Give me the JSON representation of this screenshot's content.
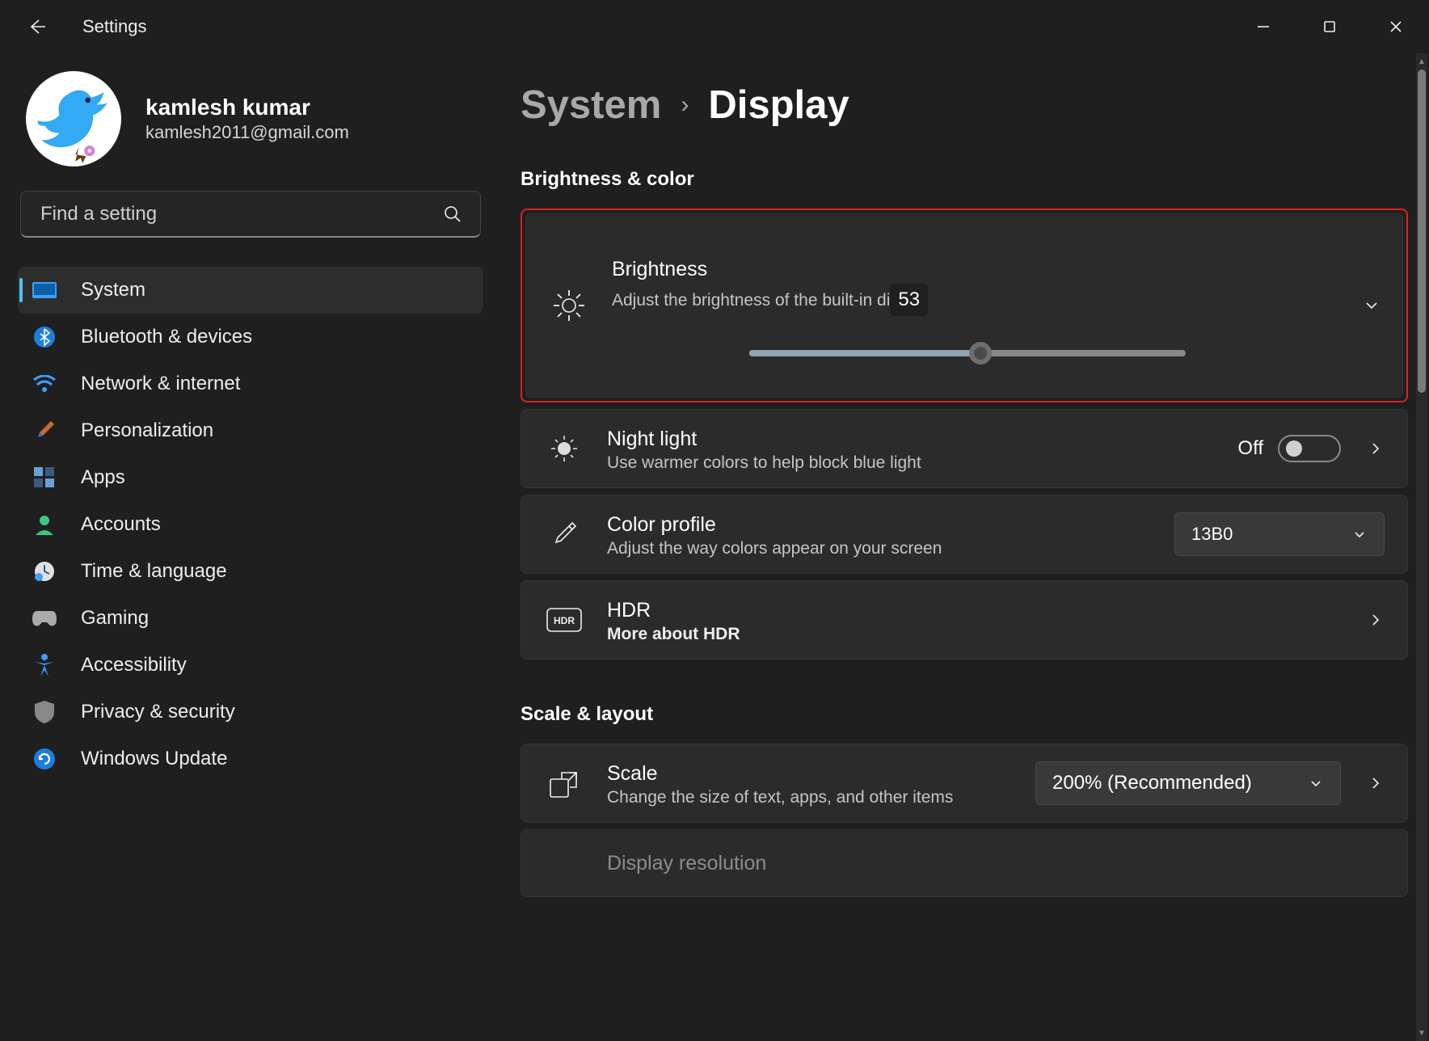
{
  "app_title": "Settings",
  "user": {
    "name": "kamlesh kumar",
    "email": "kamlesh2011@gmail.com"
  },
  "search": {
    "placeholder": "Find a setting"
  },
  "nav": [
    {
      "id": "system",
      "label": "System",
      "active": true
    },
    {
      "id": "bluetooth",
      "label": "Bluetooth & devices"
    },
    {
      "id": "network",
      "label": "Network & internet"
    },
    {
      "id": "personalization",
      "label": "Personalization"
    },
    {
      "id": "apps",
      "label": "Apps"
    },
    {
      "id": "accounts",
      "label": "Accounts"
    },
    {
      "id": "time",
      "label": "Time & language"
    },
    {
      "id": "gaming",
      "label": "Gaming"
    },
    {
      "id": "accessibility",
      "label": "Accessibility"
    },
    {
      "id": "privacy",
      "label": "Privacy & security"
    },
    {
      "id": "update",
      "label": "Windows Update"
    }
  ],
  "breadcrumb": {
    "parent": "System",
    "current": "Display"
  },
  "sections": {
    "brightness_color": {
      "title": "Brightness & color",
      "brightness": {
        "title": "Brightness",
        "subtitle": "Adjust the brightness of the built-in display",
        "subtitle_visible": "Adjust the brightness of the built-in di",
        "value": 53
      },
      "night_light": {
        "title": "Night light",
        "subtitle": "Use warmer colors to help block blue light",
        "state_label": "Off",
        "state": false
      },
      "color_profile": {
        "title": "Color profile",
        "subtitle": "Adjust the way colors appear on your screen",
        "value": "13B0"
      },
      "hdr": {
        "title": "HDR",
        "subtitle": "More about HDR"
      }
    },
    "scale_layout": {
      "title": "Scale & layout",
      "scale": {
        "title": "Scale",
        "subtitle": "Change the size of text, apps, and other items",
        "value": "200% (Recommended)"
      },
      "display_resolution": {
        "title": "Display resolution"
      }
    }
  }
}
